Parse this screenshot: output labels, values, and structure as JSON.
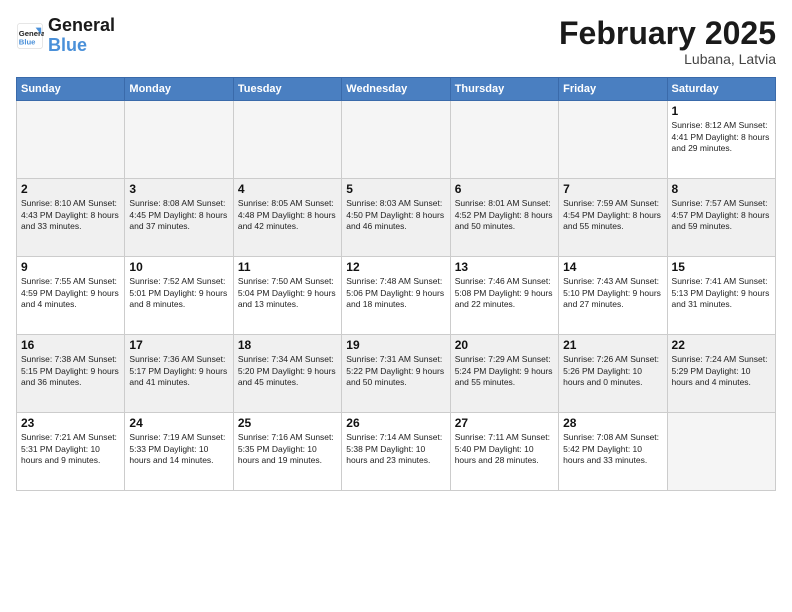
{
  "logo": {
    "line1": "General",
    "line2": "Blue"
  },
  "title": "February 2025",
  "subtitle": "Lubana, Latvia",
  "days_header": [
    "Sunday",
    "Monday",
    "Tuesday",
    "Wednesday",
    "Thursday",
    "Friday",
    "Saturday"
  ],
  "weeks": [
    [
      {
        "day": "",
        "info": ""
      },
      {
        "day": "",
        "info": ""
      },
      {
        "day": "",
        "info": ""
      },
      {
        "day": "",
        "info": ""
      },
      {
        "day": "",
        "info": ""
      },
      {
        "day": "",
        "info": ""
      },
      {
        "day": "1",
        "info": "Sunrise: 8:12 AM\nSunset: 4:41 PM\nDaylight: 8 hours and 29 minutes."
      }
    ],
    [
      {
        "day": "2",
        "info": "Sunrise: 8:10 AM\nSunset: 4:43 PM\nDaylight: 8 hours and 33 minutes."
      },
      {
        "day": "3",
        "info": "Sunrise: 8:08 AM\nSunset: 4:45 PM\nDaylight: 8 hours and 37 minutes."
      },
      {
        "day": "4",
        "info": "Sunrise: 8:05 AM\nSunset: 4:48 PM\nDaylight: 8 hours and 42 minutes."
      },
      {
        "day": "5",
        "info": "Sunrise: 8:03 AM\nSunset: 4:50 PM\nDaylight: 8 hours and 46 minutes."
      },
      {
        "day": "6",
        "info": "Sunrise: 8:01 AM\nSunset: 4:52 PM\nDaylight: 8 hours and 50 minutes."
      },
      {
        "day": "7",
        "info": "Sunrise: 7:59 AM\nSunset: 4:54 PM\nDaylight: 8 hours and 55 minutes."
      },
      {
        "day": "8",
        "info": "Sunrise: 7:57 AM\nSunset: 4:57 PM\nDaylight: 8 hours and 59 minutes."
      }
    ],
    [
      {
        "day": "9",
        "info": "Sunrise: 7:55 AM\nSunset: 4:59 PM\nDaylight: 9 hours and 4 minutes."
      },
      {
        "day": "10",
        "info": "Sunrise: 7:52 AM\nSunset: 5:01 PM\nDaylight: 9 hours and 8 minutes."
      },
      {
        "day": "11",
        "info": "Sunrise: 7:50 AM\nSunset: 5:04 PM\nDaylight: 9 hours and 13 minutes."
      },
      {
        "day": "12",
        "info": "Sunrise: 7:48 AM\nSunset: 5:06 PM\nDaylight: 9 hours and 18 minutes."
      },
      {
        "day": "13",
        "info": "Sunrise: 7:46 AM\nSunset: 5:08 PM\nDaylight: 9 hours and 22 minutes."
      },
      {
        "day": "14",
        "info": "Sunrise: 7:43 AM\nSunset: 5:10 PM\nDaylight: 9 hours and 27 minutes."
      },
      {
        "day": "15",
        "info": "Sunrise: 7:41 AM\nSunset: 5:13 PM\nDaylight: 9 hours and 31 minutes."
      }
    ],
    [
      {
        "day": "16",
        "info": "Sunrise: 7:38 AM\nSunset: 5:15 PM\nDaylight: 9 hours and 36 minutes."
      },
      {
        "day": "17",
        "info": "Sunrise: 7:36 AM\nSunset: 5:17 PM\nDaylight: 9 hours and 41 minutes."
      },
      {
        "day": "18",
        "info": "Sunrise: 7:34 AM\nSunset: 5:20 PM\nDaylight: 9 hours and 45 minutes."
      },
      {
        "day": "19",
        "info": "Sunrise: 7:31 AM\nSunset: 5:22 PM\nDaylight: 9 hours and 50 minutes."
      },
      {
        "day": "20",
        "info": "Sunrise: 7:29 AM\nSunset: 5:24 PM\nDaylight: 9 hours and 55 minutes."
      },
      {
        "day": "21",
        "info": "Sunrise: 7:26 AM\nSunset: 5:26 PM\nDaylight: 10 hours and 0 minutes."
      },
      {
        "day": "22",
        "info": "Sunrise: 7:24 AM\nSunset: 5:29 PM\nDaylight: 10 hours and 4 minutes."
      }
    ],
    [
      {
        "day": "23",
        "info": "Sunrise: 7:21 AM\nSunset: 5:31 PM\nDaylight: 10 hours and 9 minutes."
      },
      {
        "day": "24",
        "info": "Sunrise: 7:19 AM\nSunset: 5:33 PM\nDaylight: 10 hours and 14 minutes."
      },
      {
        "day": "25",
        "info": "Sunrise: 7:16 AM\nSunset: 5:35 PM\nDaylight: 10 hours and 19 minutes."
      },
      {
        "day": "26",
        "info": "Sunrise: 7:14 AM\nSunset: 5:38 PM\nDaylight: 10 hours and 23 minutes."
      },
      {
        "day": "27",
        "info": "Sunrise: 7:11 AM\nSunset: 5:40 PM\nDaylight: 10 hours and 28 minutes."
      },
      {
        "day": "28",
        "info": "Sunrise: 7:08 AM\nSunset: 5:42 PM\nDaylight: 10 hours and 33 minutes."
      },
      {
        "day": "",
        "info": ""
      }
    ]
  ]
}
